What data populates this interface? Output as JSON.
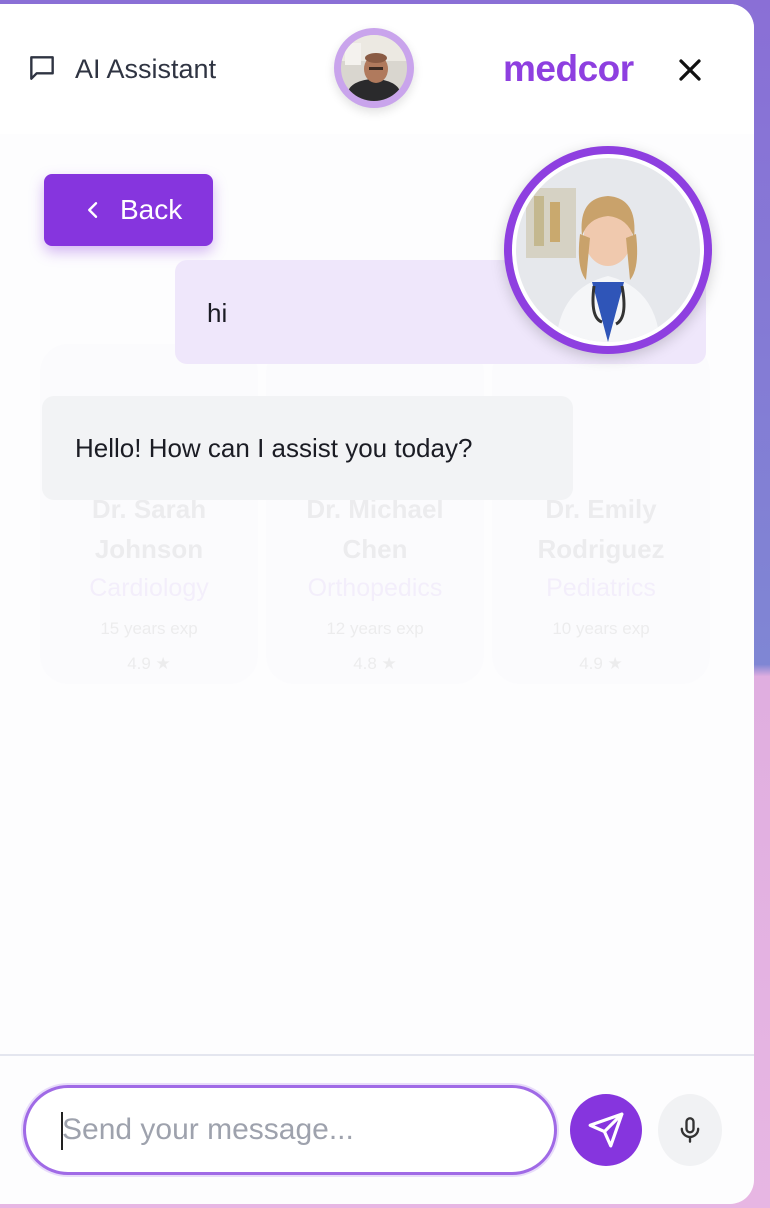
{
  "header": {
    "title": "AI Assistant",
    "brand": "medcor",
    "chat_icon": "chat-bubble-icon",
    "close_icon": "close-icon"
  },
  "back_button": {
    "label": "Back",
    "icon": "chevron-left-icon"
  },
  "messages": [
    {
      "role": "user",
      "text": "hi"
    },
    {
      "role": "assistant",
      "text": "Hello! How can I assist you today?"
    }
  ],
  "background_doctors": [
    {
      "name_line1": "Dr. Sarah",
      "name_line2": "Johnson",
      "specialty": "Cardiology",
      "meta_line1": "15 years exp",
      "meta_line2": "4.9 ★"
    },
    {
      "name_line1": "Dr. Michael",
      "name_line2": "Chen",
      "specialty": "Orthopedics",
      "meta_line1": "12 years exp",
      "meta_line2": "4.8 ★"
    },
    {
      "name_line1": "Dr. Emily",
      "name_line2": "Rodriguez",
      "specialty": "Pediatrics",
      "meta_line1": "10 years exp",
      "meta_line2": "4.9 ★"
    }
  ],
  "composer": {
    "placeholder": "Send your message...",
    "value": "",
    "send_icon": "send-icon",
    "mic_icon": "microphone-icon"
  },
  "colors": {
    "accent": "#8635de",
    "brand": "#8e3fe0",
    "user_bubble": "#efe7fb",
    "bot_bubble": "#f2f3f5"
  }
}
